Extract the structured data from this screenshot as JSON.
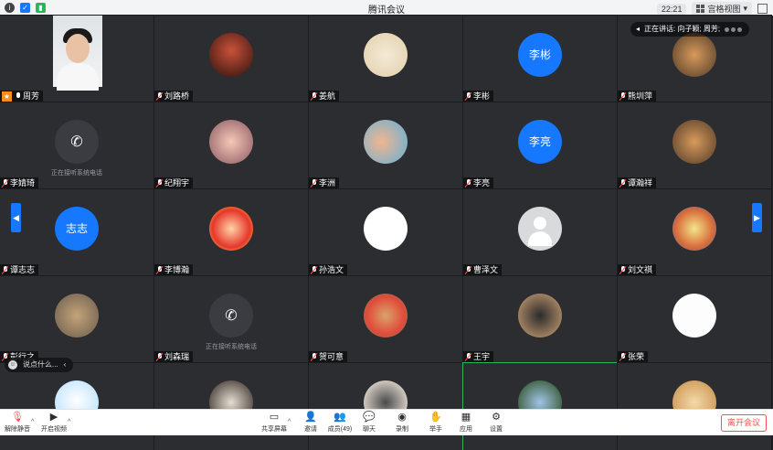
{
  "titlebar": {
    "title": "腾讯会议",
    "clock": "22:21",
    "view_label": "宫格视图",
    "icons": [
      "info-icon",
      "shield-icon",
      "signal-icon"
    ]
  },
  "speaking_indicator": "正在讲话: 向子颖; 周芳;",
  "calling_text": "正在接听系统电话",
  "chat_hint": "说点什么...",
  "participants": [
    {
      "name": "周芳",
      "kind": "video",
      "host": true
    },
    {
      "name": "刘路桥",
      "kind": "photo",
      "pattern": "pattern-a"
    },
    {
      "name": "姜航",
      "kind": "photo",
      "pattern": "pattern-b"
    },
    {
      "name": "李彬",
      "kind": "initials",
      "initials": "李彬"
    },
    {
      "name": "熊圳萍",
      "kind": "photo",
      "pattern": "pattern-e"
    },
    {
      "name": "李婧琦",
      "kind": "phone"
    },
    {
      "name": "纪翔宇",
      "kind": "photo",
      "pattern": "pattern-c"
    },
    {
      "name": "李洲",
      "kind": "photo",
      "pattern": "pattern-d"
    },
    {
      "name": "李亮",
      "kind": "initials",
      "initials": "李亮"
    },
    {
      "name": "谭瀚祥",
      "kind": "photo",
      "pattern": "pattern-e"
    },
    {
      "name": "谭志志",
      "kind": "initials",
      "initials": "志志"
    },
    {
      "name": "李博瀚",
      "kind": "photo",
      "pattern": "pattern-f"
    },
    {
      "name": "孙浩文",
      "kind": "photo",
      "pattern": "pattern-g"
    },
    {
      "name": "曹泽文",
      "kind": "default"
    },
    {
      "name": "刘文祺",
      "kind": "photo",
      "pattern": "pattern-i"
    },
    {
      "name": "彭行之",
      "kind": "photo",
      "pattern": "pattern-j"
    },
    {
      "name": "刘森瑞",
      "kind": "phone"
    },
    {
      "name": "贺可意",
      "kind": "photo",
      "pattern": "pattern-l"
    },
    {
      "name": "王宇",
      "kind": "photo",
      "pattern": "pattern-m"
    },
    {
      "name": "张荣",
      "kind": "photo",
      "pattern": "pattern-n"
    },
    {
      "name": "",
      "kind": "photo",
      "pattern": "pattern-o"
    },
    {
      "name": "",
      "kind": "photo",
      "pattern": "pattern-p"
    },
    {
      "name": "",
      "kind": "photo",
      "pattern": "pattern-k"
    },
    {
      "name": "",
      "kind": "photo",
      "pattern": "pattern-q"
    },
    {
      "name": "",
      "kind": "photo",
      "pattern": "pattern-r"
    }
  ],
  "toolbar": {
    "mute_label": "解除静音",
    "video_label": "开启视频",
    "share_label": "共享屏幕",
    "invite_label": "邀请",
    "members_label": "成员(49)",
    "chat_label": "聊天",
    "record_label": "录制",
    "raise_label": "举手",
    "apps_label": "应用",
    "settings_label": "设置",
    "leave_label": "离开会议"
  },
  "colors": {
    "accent": "#1677ff",
    "leave": "#ff4d4f",
    "host": "#ff8c1a"
  }
}
